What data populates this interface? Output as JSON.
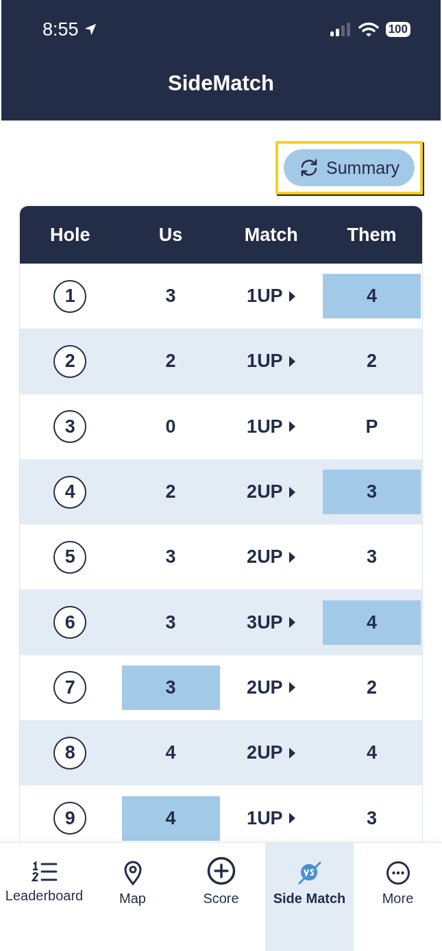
{
  "status_bar": {
    "time": "8:55",
    "battery": "100"
  },
  "header": {
    "title": "SideMatch"
  },
  "summary_button": {
    "label": "Summary",
    "highlighted": true
  },
  "table": {
    "columns": [
      "Hole",
      "Us",
      "Match",
      "Them"
    ],
    "rows": [
      {
        "hole": "1",
        "us": "3",
        "match": "1UP",
        "them": "4",
        "us_highlighted": false,
        "them_highlighted": true
      },
      {
        "hole": "2",
        "us": "2",
        "match": "1UP",
        "them": "2",
        "us_highlighted": false,
        "them_highlighted": false
      },
      {
        "hole": "3",
        "us": "0",
        "match": "1UP",
        "them": "P",
        "us_highlighted": false,
        "them_highlighted": false
      },
      {
        "hole": "4",
        "us": "2",
        "match": "2UP",
        "them": "3",
        "us_highlighted": false,
        "them_highlighted": true
      },
      {
        "hole": "5",
        "us": "3",
        "match": "2UP",
        "them": "3",
        "us_highlighted": false,
        "them_highlighted": false
      },
      {
        "hole": "6",
        "us": "3",
        "match": "3UP",
        "them": "4",
        "us_highlighted": false,
        "them_highlighted": true
      },
      {
        "hole": "7",
        "us": "3",
        "match": "2UP",
        "them": "2",
        "us_highlighted": true,
        "them_highlighted": false
      },
      {
        "hole": "8",
        "us": "4",
        "match": "2UP",
        "them": "4",
        "us_highlighted": false,
        "them_highlighted": false
      },
      {
        "hole": "9",
        "us": "4",
        "match": "1UP",
        "them": "3",
        "us_highlighted": true,
        "them_highlighted": false
      }
    ]
  },
  "tab_bar": [
    {
      "kind": "leaderboard",
      "label": "Leaderboard",
      "selected": false
    },
    {
      "kind": "map",
      "label": "Map",
      "selected": false
    },
    {
      "kind": "score",
      "label": "Score",
      "selected": false
    },
    {
      "kind": "versus",
      "label": "Side Match",
      "selected": true
    },
    {
      "kind": "more",
      "label": "More",
      "selected": false
    }
  ]
}
